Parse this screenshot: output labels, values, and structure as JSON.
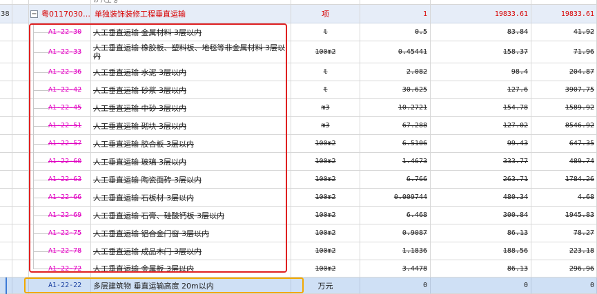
{
  "top_partial": {
    "idx": "",
    "text": "ゎ  八土  ゟ"
  },
  "parent": {
    "idx": "38",
    "expander": "−",
    "code": "粤0117030…",
    "name": "单独装饰装修工程垂直运输",
    "unit": "项",
    "qty": "1",
    "price": "19833.61",
    "total": "19833.61"
  },
  "rows": [
    {
      "code": "A1-22-30",
      "name": "人工垂直运输 金属材料 3层以内",
      "unit": "t",
      "qty": "0.5",
      "price": "83.84",
      "total": "41.92"
    },
    {
      "code": "A1-22-33",
      "name": "人工垂直运输 橡胶板、塑料板、地毯等非金属材料 3层以内",
      "unit": "100m2",
      "qty": "0.45441",
      "price": "158.37",
      "total": "71.96"
    },
    {
      "code": "A1-22-36",
      "name": "人工垂直运输 水泥 3层以内",
      "unit": "t",
      "qty": "2.082",
      "price": "98.4",
      "total": "204.87"
    },
    {
      "code": "A1-22-42",
      "name": "人工垂直运输 砂浆 3层以内",
      "unit": "t",
      "qty": "30.625",
      "price": "127.6",
      "total": "3907.75"
    },
    {
      "code": "A1-22-45",
      "name": "人工垂直运输 中砂 3层以内",
      "unit": "m3",
      "qty": "10.2721",
      "price": "154.78",
      "total": "1589.92"
    },
    {
      "code": "A1-22-51",
      "name": "人工垂直运输 砌块 3层以内",
      "unit": "m3",
      "qty": "67.288",
      "price": "127.02",
      "total": "8546.92"
    },
    {
      "code": "A1-22-57",
      "name": "人工垂直运输 胶合板 3层以内",
      "unit": "100m2",
      "qty": "6.5106",
      "price": "99.43",
      "total": "647.35"
    },
    {
      "code": "A1-22-60",
      "name": "人工垂直运输 玻璃 3层以内",
      "unit": "100m2",
      "qty": "1.4673",
      "price": "333.77",
      "total": "489.74"
    },
    {
      "code": "A1-22-63",
      "name": "人工垂直运输 陶瓷面砖 3层以内",
      "unit": "100m2",
      "qty": "6.766",
      "price": "263.71",
      "total": "1784.26"
    },
    {
      "code": "A1-22-66",
      "name": "人工垂直运输 石板材 3层以内",
      "unit": "100m2",
      "qty": "0.009744",
      "price": "480.34",
      "total": "4.68"
    },
    {
      "code": "A1-22-69",
      "name": "人工垂直运输 石膏、硅酸钙板 3层以内",
      "unit": "100m2",
      "qty": "6.468",
      "price": "300.84",
      "total": "1945.83"
    },
    {
      "code": "A1-22-75",
      "name": "人工垂直运输 铝合金门窗 3层以内",
      "unit": "100m2",
      "qty": "0.9087",
      "price": "86.13",
      "total": "78.27"
    },
    {
      "code": "A1-22-78",
      "name": "人工垂直运输 成品木门 3层以内",
      "unit": "100m2",
      "qty": "1.1836",
      "price": "188.56",
      "total": "223.18"
    },
    {
      "code": "A1-22-72",
      "name": "人工垂直运输 金属板 3层以内",
      "unit": "100m2",
      "qty": "3.4478",
      "price": "86.13",
      "total": "296.96"
    }
  ],
  "last": {
    "code": "A1-22-22",
    "name": "多层建筑物 垂直运输高度 20m以内",
    "unit": "万元",
    "qty": "0",
    "price": "0",
    "total": "0"
  },
  "colors": {
    "strike_code": "#e000c0",
    "parent_text": "#d80000",
    "highlight_red": "#e02020",
    "highlight_orange": "#f2a800",
    "selected_row": "#cfe0f5"
  }
}
